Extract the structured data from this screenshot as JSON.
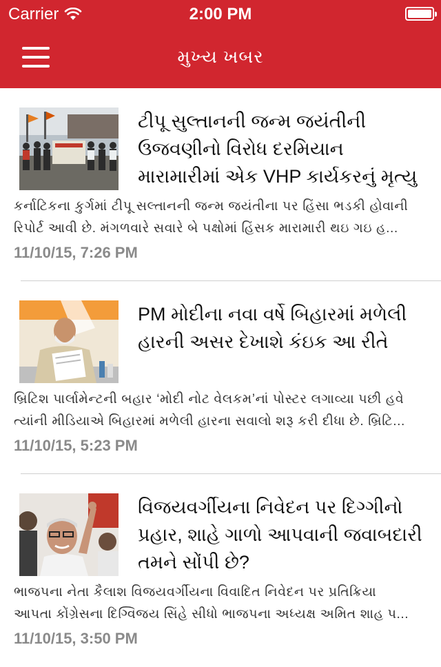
{
  "status_bar": {
    "carrier": "Carrier",
    "time": "2:00 PM",
    "battery_level": 1.0
  },
  "navbar": {
    "title": "મુખ્ય ખબર",
    "menu_icon": "hamburger-menu-icon"
  },
  "colors": {
    "header_bg": "#d1262f",
    "date_text": "#8a8a8a",
    "divider": "#cfcfcf"
  },
  "articles": [
    {
      "headline": "ટીપૂ સુલ્તાનની જન્મ જયંતીની ઉજવણીનો વિરોધ દરમિયાન મારામારીમાં એક VHP કાર્યકરનું મૃત્યુ",
      "summary_line1": "કર્નાટિકના કુર્ગમાં ટીપૂ સલ્તાનની જન્મ જયંતીના પર હિંસા ભડકી હોવાની",
      "summary_line2": "રિપોર્ટ આવી છે. મંગળવારે સવારે બે પક્ષોમાં હિંસક મારામારી થઇ ગઇ હ...",
      "date": "11/10/15, 7:26 PM",
      "image": "protest-crowd-photo"
    },
    {
      "headline": "PM મોદીના નવા વર્ષે બિહારમાં મળેલી હારની અસર દેખાશે કંઇક આ રીતે",
      "summary_line1": "બ્રિટિશ પાર્લામેન્ટની બહાર ‘મોદી નોટ વેલકમ’નાં પોસ્ટર લગાવ્યા પછી હવે",
      "summary_line2": "ત્યાંની મીડિયાએ બિહારમાં મળેલી હારના સવાલો શરૂ કરી દીધા છે. બ્રિટિ...",
      "date": "11/10/15, 5:23 PM",
      "image": "modi-reading-photo"
    },
    {
      "headline": "વિજયવર્ગીયના નિવેદન પર દિગ્ગીનો પ્રહાર, શાહે ગાળો આપવાની જવાબદારી તમને સોંપી છે?",
      "summary_line1": "ભાજપના નેતા કૈલાશ વિજયવર્ગીયના વિવાદિત નિવેદન પર પ્રતિક્રિયા",
      "summary_line2": "આપતા કોંગ્રેસના દિગ્વિજય સિંહે સીધો ભાજપના અધ્યક્ષ અમિત શાહ પ...",
      "date": "11/10/15, 3:50 PM",
      "image": "digvijay-pointing-photo"
    }
  ]
}
